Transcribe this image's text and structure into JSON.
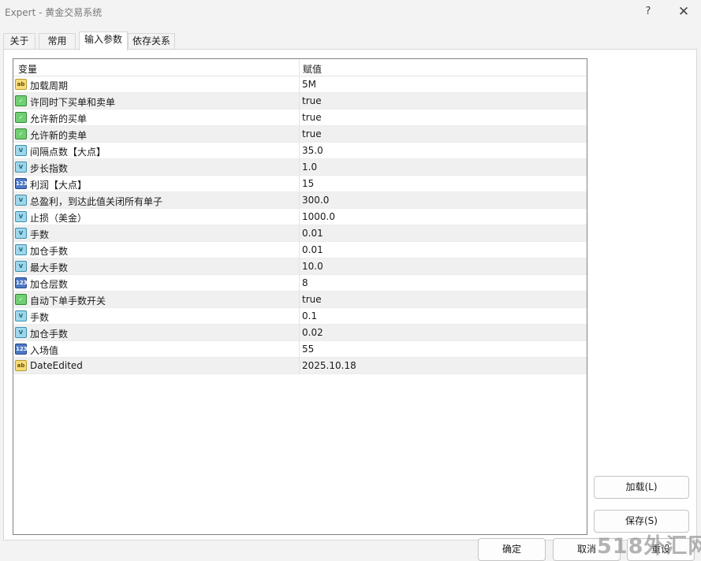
{
  "window": {
    "title": "Expert - 黄金交易系统",
    "help_glyph": "?",
    "close_glyph": "✕"
  },
  "tabs": [
    {
      "label": "关于",
      "active": false
    },
    {
      "label": "常用",
      "active": false
    },
    {
      "label": "输入参数",
      "active": true
    },
    {
      "label": "依存关系",
      "active": false
    }
  ],
  "grid": {
    "col_variable": "变量",
    "col_value": "赋值",
    "rows": [
      {
        "icon": "string-type-icon",
        "glyph": "ab",
        "name": "加载周期",
        "value": " 5M"
      },
      {
        "icon": "bool-type-icon",
        "glyph": "✓",
        "name": "许同时下买单和卖单",
        "value": "true"
      },
      {
        "icon": "bool-type-icon",
        "glyph": "✓",
        "name": "允许新的买单",
        "value": "true"
      },
      {
        "icon": "bool-type-icon",
        "glyph": "✓",
        "name": "允许新的卖单",
        "value": "true"
      },
      {
        "icon": "double-type-icon",
        "glyph": "V",
        "name": "间隔点数【大点】",
        "value": "35.0"
      },
      {
        "icon": "double-type-icon",
        "glyph": "V",
        "name": "步长指数",
        "value": "1.0"
      },
      {
        "icon": "int-type-icon",
        "glyph": "123",
        "name": "利润【大点】",
        "value": "15"
      },
      {
        "icon": "double-type-icon",
        "glyph": "V",
        "name": "总盈利，到达此值关闭所有单子",
        "value": "300.0"
      },
      {
        "icon": "double-type-icon",
        "glyph": "V",
        "name": "止损（美金）",
        "value": "1000.0"
      },
      {
        "icon": "double-type-icon",
        "glyph": "V",
        "name": "手数",
        "value": "0.01"
      },
      {
        "icon": "double-type-icon",
        "glyph": "V",
        "name": "加仓手数",
        "value": "0.01"
      },
      {
        "icon": "double-type-icon",
        "glyph": "V",
        "name": "最大手数",
        "value": "10.0"
      },
      {
        "icon": "int-type-icon",
        "glyph": "123",
        "name": "加仓层数",
        "value": "8"
      },
      {
        "icon": "bool-type-icon",
        "glyph": "✓",
        "name": "自动下单手数开关",
        "value": "true"
      },
      {
        "icon": "double-type-icon",
        "glyph": "V",
        "name": "手数",
        "value": "0.1"
      },
      {
        "icon": "double-type-icon",
        "glyph": "V",
        "name": "加仓手数",
        "value": "0.02"
      },
      {
        "icon": "int-type-icon",
        "glyph": "123",
        "name": "入场值",
        "value": "55"
      },
      {
        "icon": "string-type-icon",
        "glyph": "ab",
        "name": "DateEdited",
        "value": "2025.10.18"
      }
    ]
  },
  "buttons": {
    "load": "加载(L)",
    "save": "保存(S)",
    "ok": "确定",
    "cancel": "取消",
    "reset": "重设"
  },
  "watermark": "518外汇网",
  "colors": {
    "window_bg": "#f3f3f3",
    "grid_border": "#828282",
    "alt_row": "#f0f0f0"
  }
}
